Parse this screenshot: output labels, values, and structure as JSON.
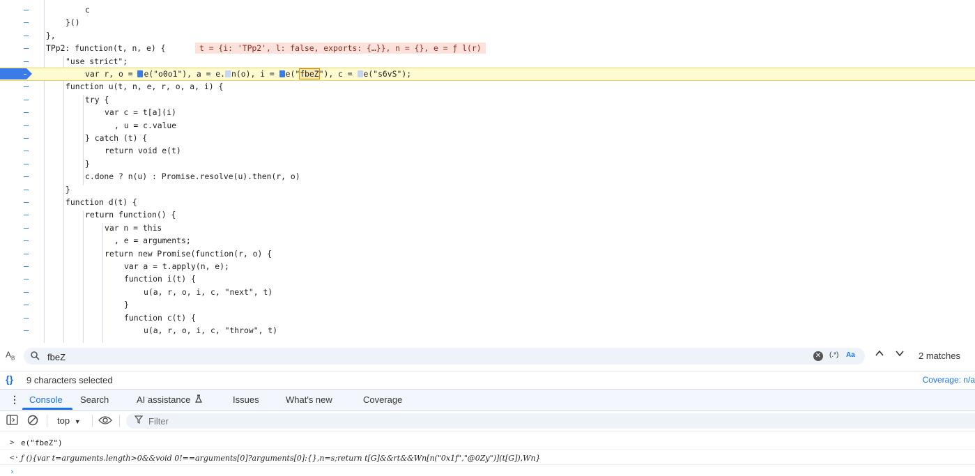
{
  "editor": {
    "gutter_marker": "–",
    "lines": [
      {
        "text": "        c"
      },
      {
        "text": "    }()"
      },
      {
        "text": "},"
      },
      {
        "text": "TPp2: function(t, n, e) {"
      },
      {
        "text": "    \"use strict\";"
      },
      {
        "text": "    var r, o = e(\"o0o1\"), a = e.n(o), i = e(\"fbeZ\"), c = e(\"s6vS\");"
      },
      {
        "text": "    function u(t, n, e, r, o, a, i) {"
      },
      {
        "text": "        try {"
      },
      {
        "text": "            var c = t[a](i)"
      },
      {
        "text": "              , u = c.value"
      },
      {
        "text": "        } catch (t) {"
      },
      {
        "text": "            return void e(t)"
      },
      {
        "text": "        }"
      },
      {
        "text": "        c.done ? n(u) : Promise.resolve(u).then(r, o)"
      },
      {
        "text": "    }"
      },
      {
        "text": "    function d(t) {"
      },
      {
        "text": "        return function() {"
      },
      {
        "text": "            var n = this"
      },
      {
        "text": "              , e = arguments;"
      },
      {
        "text": "            return new Promise(function(r, o) {"
      },
      {
        "text": "                var a = t.apply(n, e);"
      },
      {
        "text": "                function i(t) {"
      },
      {
        "text": "                    u(a, r, o, i, c, \"next\", t)"
      },
      {
        "text": "                }"
      },
      {
        "text": "                function c(t) {"
      },
      {
        "text": "                    u(a, r, o, i, c, \"throw\", t)"
      }
    ],
    "inline_values": "t = {i: 'TPp2', l: false, exports: {…}}, n = {}, e = ƒ l(r)",
    "exec_line": {
      "p1": "var r, o = ",
      "p2": "e(\"o0o1\"), a = e.",
      "p3": "n(o), i = ",
      "p4": "e(\"",
      "p5": "fbeZ",
      "p6": "\"), c = ",
      "p7": "e(\"s6vS\");"
    }
  },
  "search": {
    "case_label": "A",
    "case_sub": "B",
    "query": "fbeZ",
    "regex_label": "(.*)",
    "case_sensitive_label": "Aa",
    "matches": "2 matches"
  },
  "status": {
    "braces": "{}",
    "selection": "9 characters selected",
    "coverage": "Coverage: n/a"
  },
  "drawer": {
    "tabs": [
      "Console",
      "Search",
      "AI assistance",
      "Issues",
      "What's new",
      "Coverage"
    ]
  },
  "console_toolbar": {
    "context": "top",
    "filter_placeholder": "Filter"
  },
  "console": {
    "input_prompt": ">",
    "input": "e(\"fbeZ\")",
    "result_prompt": "<·",
    "result": "ƒ (){var t=arguments.length>0&&void 0!==arguments[0]?arguments[0]:{},n=s;return t[G]&&rt&&Wn[n(\"0x1f\",\"@0Zy\")](t[G]),Wn}",
    "caret": "›"
  },
  "colors": {
    "accent": "#1a73e8",
    "exec_highlight": "#fffbd1",
    "breakpoint": "#3b7be8"
  }
}
